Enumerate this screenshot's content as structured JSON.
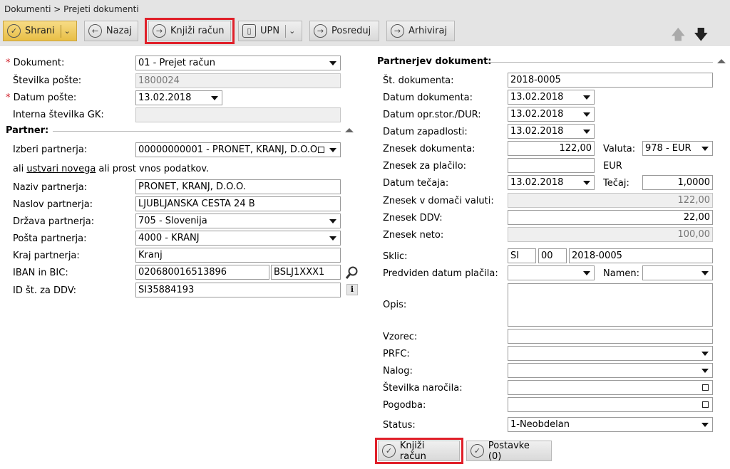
{
  "breadcrumb": "Dokumenti > Prejeti dokumenti",
  "toolbar": {
    "save": "Shrani",
    "back": "Nazaj",
    "post": "Knjiži račun",
    "upn": "UPN",
    "forward": "Posreduj",
    "archive": "Arhiviraj"
  },
  "left": {
    "dokument": {
      "label": "Dokument:",
      "value": "01 - Prejet račun"
    },
    "st_poste": {
      "label": "Številka pošte:",
      "value": "1800024"
    },
    "datum_poste": {
      "label": "Datum pošte:",
      "value": "13.02.2018"
    },
    "interna_gk": {
      "label": "Interna številka GK:",
      "value": ""
    },
    "partner_section": "Partner:",
    "izberi": {
      "label": "Izberi partnerja:",
      "value": "00000000001 - PRONET, KRANJ, D.O.O"
    },
    "hint_pre": "ali ",
    "hint_link": "ustvari novega",
    "hint_post": " ali prost vnos podatkov.",
    "naziv": {
      "label": "Naziv partnerja:",
      "value": "PRONET, KRANJ, D.O.O."
    },
    "naslov": {
      "label": "Naslov partnerja:",
      "value": "LJUBLJANSKA CESTA 24 B"
    },
    "drzava": {
      "label": "Država partnerja:",
      "value": "705 - Slovenija"
    },
    "posta": {
      "label": "Pošta partnerja:",
      "value": "4000 - KRANJ"
    },
    "kraj": {
      "label": "Kraj partnerja:",
      "value": "Kranj"
    },
    "iban": {
      "label": "IBAN in BIC:",
      "iban": "020680016513896",
      "bic": "BSLJ1XXX1"
    },
    "ddv": {
      "label": "ID št. za DDV:",
      "value": "SI35884193"
    }
  },
  "right": {
    "section": "Partnerjev dokument:",
    "st_dok": {
      "label": "Št. dokumenta:",
      "value": "2018-0005"
    },
    "datum_dok": {
      "label": "Datum dokumenta:",
      "value": "13.02.2018"
    },
    "datum_dur": {
      "label": "Datum opr.stor./DUR:",
      "value": "13.02.2018"
    },
    "datum_zap": {
      "label": "Datum zapadlosti:",
      "value": "13.02.2018"
    },
    "znesek_dok": {
      "label": "Znesek dokumenta:",
      "value": "122,00"
    },
    "valuta": {
      "label": "Valuta:",
      "value": "978 - EUR"
    },
    "znesek_plac": {
      "label": "Znesek za plačilo:",
      "value": "",
      "unit": "EUR"
    },
    "datum_tecaja": {
      "label": "Datum tečaja:",
      "value": "13.02.2018"
    },
    "tecaj": {
      "label": "Tečaj:",
      "value": "1,0000"
    },
    "znesek_dom": {
      "label": "Znesek v domači valuti:",
      "value": "122,00"
    },
    "znesek_ddv": {
      "label": "Znesek DDV:",
      "value": "22,00"
    },
    "znesek_neto": {
      "label": "Znesek neto:",
      "value": "100,00"
    },
    "sklic": {
      "label": "Sklic:",
      "model": "SI",
      "num": "00",
      "ref": "2018-0005"
    },
    "predviden": {
      "label": "Predviden datum plačila:",
      "value": ""
    },
    "namen": {
      "label": "Namen:",
      "value": ""
    },
    "opis": {
      "label": "Opis:",
      "value": ""
    },
    "vzorec": {
      "label": "Vzorec:",
      "value": ""
    },
    "prfc": {
      "label": "PRFC:",
      "value": ""
    },
    "nalog": {
      "label": "Nalog:",
      "value": ""
    },
    "st_narocila": {
      "label": "Številka naročila:",
      "value": ""
    },
    "pogodba": {
      "label": "Pogodba:",
      "value": ""
    },
    "status": {
      "label": "Status:",
      "value": "1-Neobdelan"
    }
  },
  "bottom": {
    "post": "Knjiži račun",
    "items": "Postavke (0)"
  },
  "colors": {
    "highlight": "#e0202a",
    "save_button": "#e8be45",
    "required": "#d0202a"
  }
}
